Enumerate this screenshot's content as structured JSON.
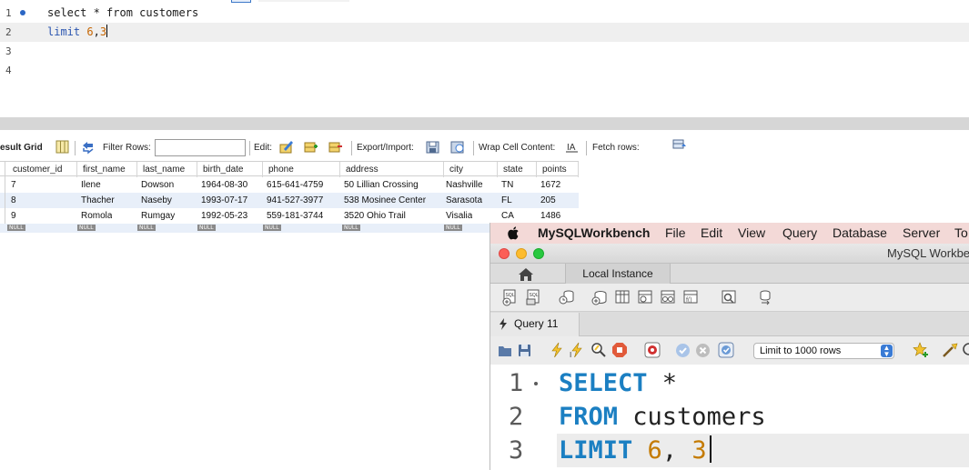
{
  "top_editor": {
    "lines": [
      {
        "num": "1",
        "tokens": [
          "select",
          " * ",
          "from",
          " customers"
        ]
      },
      {
        "num": "2",
        "kw": "limit",
        "sp": " ",
        "n1": "6",
        "comma": ",",
        "n2": "3"
      },
      {
        "num": "3"
      },
      {
        "num": "4"
      }
    ]
  },
  "result_toolbar": {
    "result_grid_label": "esult Grid",
    "filter_rows_label": "Filter Rows:",
    "filter_value": "",
    "edit_label": "Edit:",
    "export_import_label": "Export/Import:",
    "wrap_cell_label": "Wrap Cell Content:",
    "fetch_rows_label": "Fetch rows:"
  },
  "result_grid": {
    "columns": [
      "customer_id",
      "first_name",
      "last_name",
      "birth_date",
      "phone",
      "address",
      "city",
      "state",
      "points"
    ],
    "rows": [
      [
        "7",
        "Ilene",
        "Dowson",
        "1964-08-30",
        "615-641-4759",
        "50 Lillian Crossing",
        "Nashville",
        "TN",
        "1672"
      ],
      [
        "8",
        "Thacher",
        "Naseby",
        "1993-07-17",
        "941-527-3977",
        "538 Mosinee Center",
        "Sarasota",
        "FL",
        "205"
      ],
      [
        "9",
        "Romola",
        "Rumgay",
        "1992-05-23",
        "559-181-3744",
        "3520 Ohio Trail",
        "Visalia",
        "CA",
        "1486"
      ]
    ],
    "null_label": "NULL"
  },
  "workbench": {
    "menu": [
      "MySQLWorkbench",
      "File",
      "Edit",
      "View",
      "Query",
      "Database",
      "Server",
      "To"
    ],
    "window_title": "MySQL Workbe",
    "home_tab_icon": "home-icon",
    "instance_tab": "Local Instance",
    "query_tab": "Query 11",
    "limit_select": "Limit to 1000 rows",
    "editor_lines": [
      {
        "num": "1",
        "kw": "SELECT",
        "rest": " *"
      },
      {
        "num": "2",
        "kw": "FROM",
        "rest": " customers"
      },
      {
        "num": "3",
        "kw": "LIMIT",
        "n1": "6",
        "comma": ", ",
        "n2": "3"
      }
    ],
    "colors": {
      "menu_bg": "#f3d9d7",
      "keyword": "#1b7fc2",
      "number": "#c47a00",
      "close": "#fc5f57",
      "minimize": "#fdbc2e",
      "zoom": "#28c840"
    }
  }
}
